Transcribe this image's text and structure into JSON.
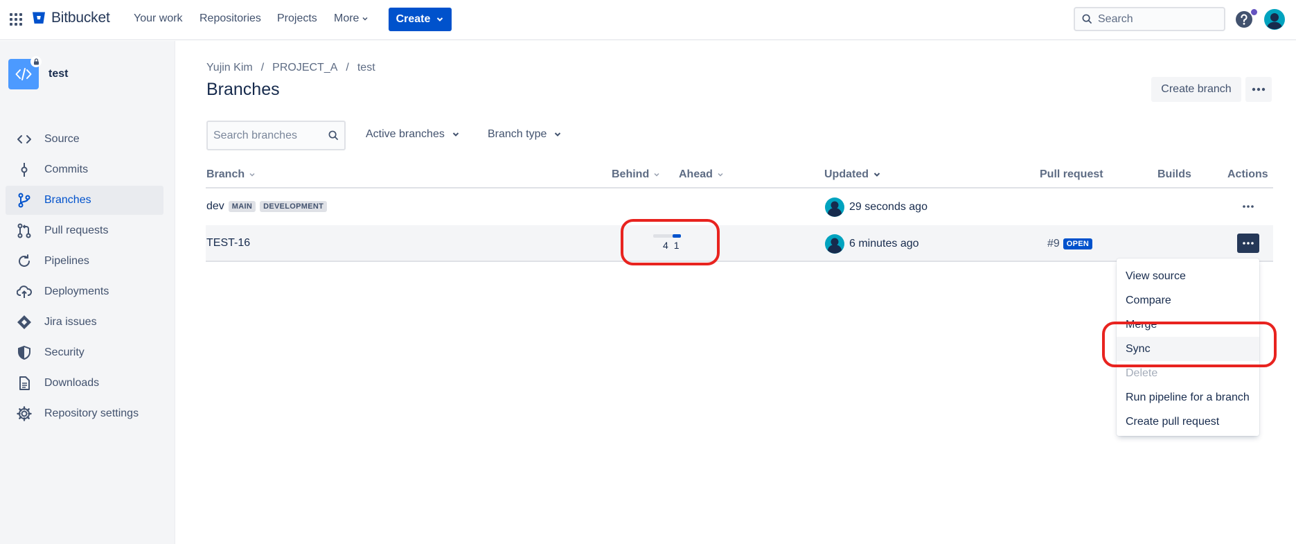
{
  "topnav": {
    "brand": "Bitbucket",
    "links": [
      "Your work",
      "Repositories",
      "Projects"
    ],
    "more_label": "More",
    "create_label": "Create",
    "search_placeholder": "Search",
    "brand_color": "#0052cc"
  },
  "sidebar": {
    "repo_name": "test",
    "items": [
      {
        "label": "Source",
        "icon": "code-icon"
      },
      {
        "label": "Commits",
        "icon": "commit-icon"
      },
      {
        "label": "Branches",
        "icon": "branch-icon",
        "active": true
      },
      {
        "label": "Pull requests",
        "icon": "pull-request-icon"
      },
      {
        "label": "Pipelines",
        "icon": "pipelines-icon"
      },
      {
        "label": "Deployments",
        "icon": "deployments-icon"
      },
      {
        "label": "Jira issues",
        "icon": "jira-icon"
      },
      {
        "label": "Security",
        "icon": "shield-icon"
      },
      {
        "label": "Downloads",
        "icon": "file-icon"
      },
      {
        "label": "Repository settings",
        "icon": "gear-icon"
      }
    ]
  },
  "breadcrumb": [
    "Yujin Kim",
    "PROJECT_A",
    "test"
  ],
  "page": {
    "title": "Branches",
    "create_branch_label": "Create branch"
  },
  "filters": {
    "search_placeholder": "Search branches",
    "active_branches_label": "Active branches",
    "branch_type_label": "Branch type"
  },
  "table": {
    "headers": {
      "branch": "Branch",
      "behind": "Behind",
      "ahead": "Ahead",
      "updated": "Updated",
      "pull_request": "Pull request",
      "builds": "Builds",
      "actions": "Actions"
    },
    "rows": [
      {
        "name": "dev",
        "labels": [
          "MAIN",
          "DEVELOPMENT"
        ],
        "updated": "29 seconds ago"
      },
      {
        "name": "TEST-16",
        "behind": "4",
        "ahead": "1",
        "updated": "6 minutes ago",
        "pr_number": "#9",
        "pr_status": "OPEN"
      }
    ]
  },
  "action_menu": {
    "items": [
      "View source",
      "Compare",
      "Merge",
      "Sync",
      "Delete",
      "Run pipeline for a branch",
      "Create pull request"
    ]
  }
}
